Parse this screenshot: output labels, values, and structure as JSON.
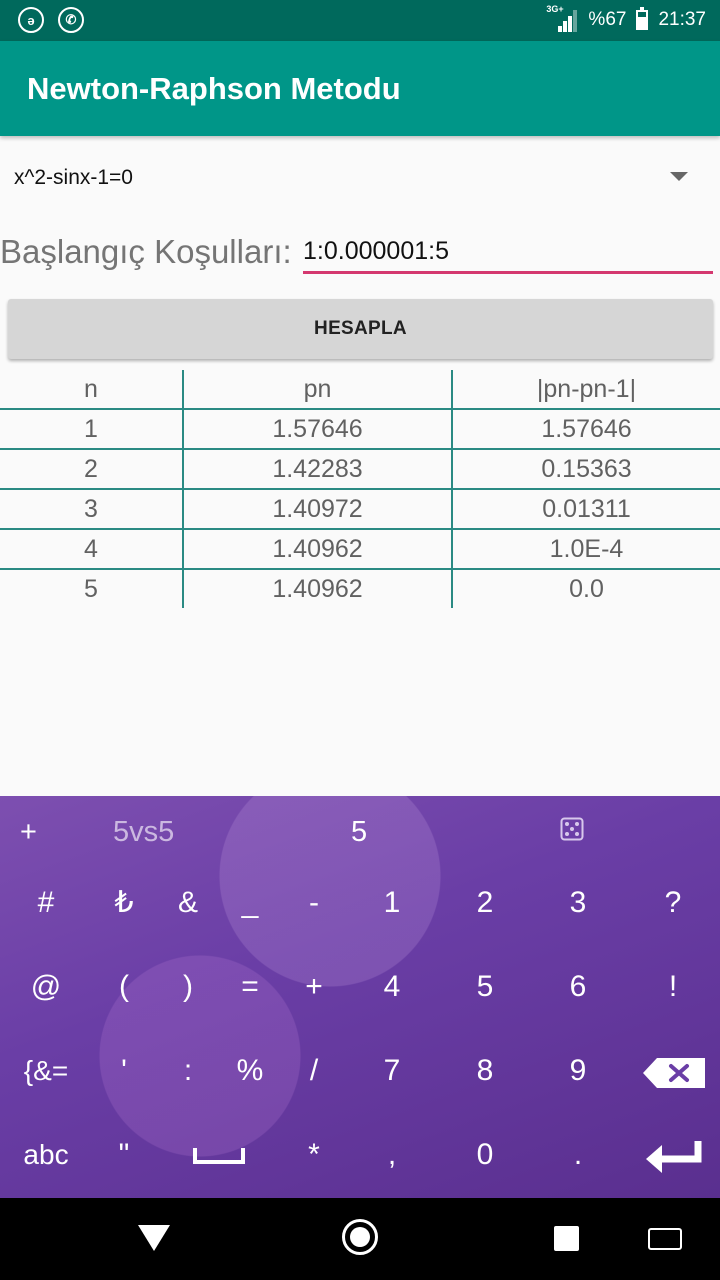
{
  "status_bar": {
    "network": "3G+",
    "battery": "%67",
    "time": "21:37",
    "battery_level": 0.67,
    "icons": [
      "bip-icon",
      "whatsapp-icon",
      "signal-icon",
      "battery-icon"
    ]
  },
  "app_bar": {
    "title": "Newton-Raphson Metodu"
  },
  "equation_spinner": {
    "selected": "x^2-sinx-1=0"
  },
  "conditions": {
    "label": "Başlangıç Koşulları:",
    "value": "1:0.000001:5"
  },
  "calculate_button": {
    "label": "HESAPLA"
  },
  "results_table": {
    "headers": [
      "n",
      "pn",
      "|pn-pn-1|"
    ],
    "rows": [
      [
        "1",
        "1.57646",
        "1.57646"
      ],
      [
        "2",
        "1.42283",
        "0.15363"
      ],
      [
        "3",
        "1.40972",
        "0.01311"
      ],
      [
        "4",
        "1.40962",
        "1.0E-4"
      ],
      [
        "5",
        "1.40962",
        "0.0"
      ]
    ]
  },
  "keyboard": {
    "suggestions": [
      "+",
      "5vs5",
      "5"
    ],
    "row1": [
      "#",
      "₺",
      "&",
      "_",
      "-",
      "1",
      "2",
      "3",
      "?"
    ],
    "row2": [
      "@",
      "(",
      ")",
      "=",
      "+",
      "4",
      "5",
      "6",
      "!"
    ],
    "row3": [
      "{&=",
      "'",
      ":",
      "%",
      "/",
      "7",
      "8",
      "9"
    ],
    "row4": [
      "abc",
      "\"",
      "*",
      ",",
      "0",
      "."
    ]
  },
  "colors": {
    "status_bar": "#00695c",
    "app_bar": "#009688",
    "input_underline": "#d4386f",
    "table_lines": "#2a8a83",
    "keyboard": "#6a3ea6"
  }
}
